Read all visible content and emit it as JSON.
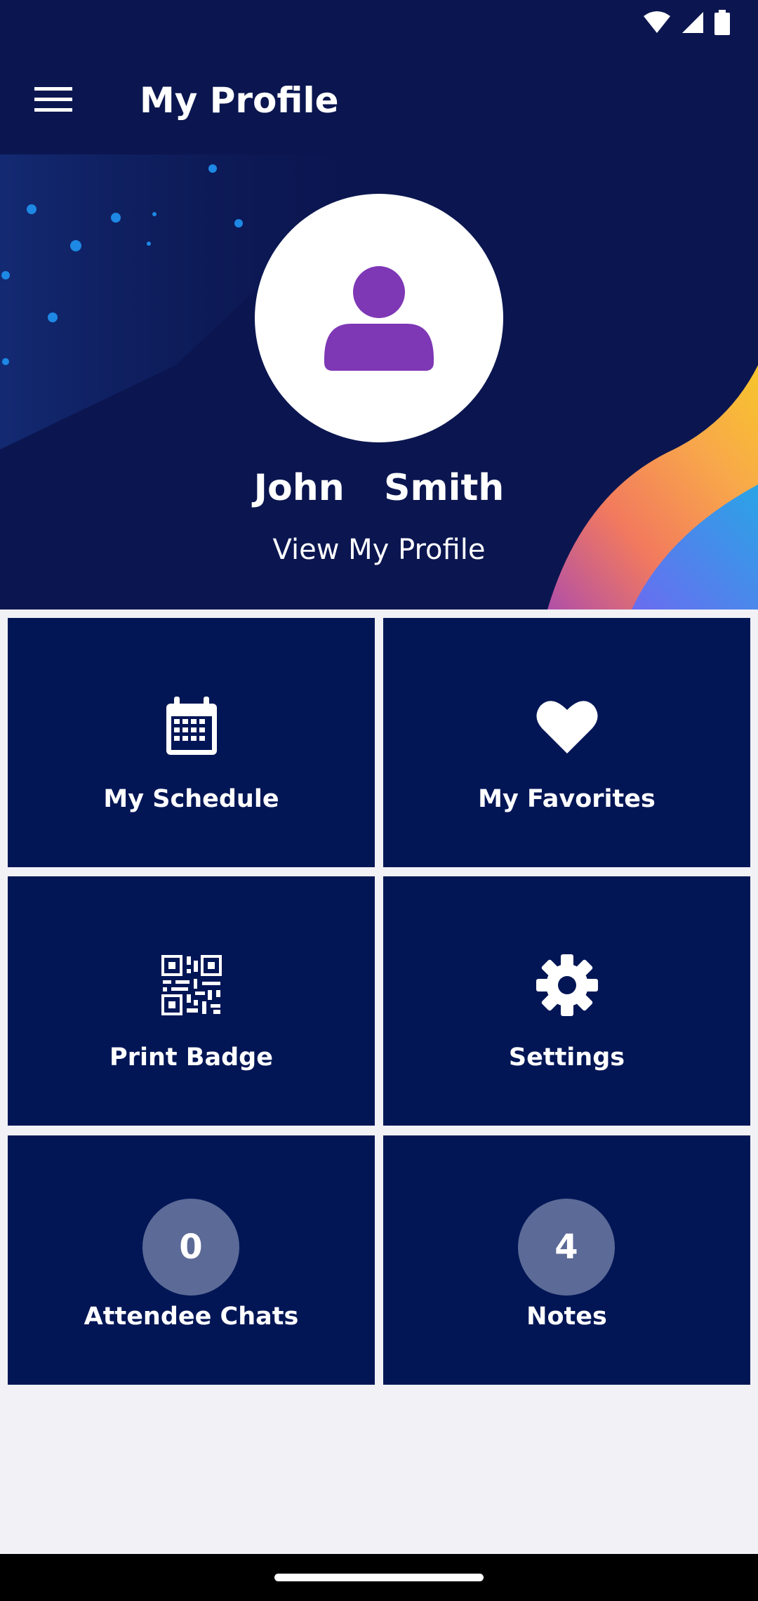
{
  "app_bar": {
    "title": "My Profile",
    "menu_icon": "hamburger-menu-icon"
  },
  "status_bar": {
    "icons": [
      "wifi-icon",
      "cellular-signal-icon",
      "battery-icon"
    ]
  },
  "profile": {
    "name": "John  Smith",
    "link": "View My Profile",
    "avatar_icon": "person-icon",
    "avatar_color": "#7e37b5"
  },
  "tiles": [
    {
      "label": "My Schedule",
      "icon": "calendar-icon"
    },
    {
      "label": "My Favorites",
      "icon": "heart-icon"
    },
    {
      "label": "Print Badge",
      "icon": "qr-code-icon"
    },
    {
      "label": "Settings",
      "icon": "gear-icon"
    },
    {
      "label": "Attendee Chats",
      "count": "0"
    },
    {
      "label": "Notes",
      "count": "4"
    }
  ],
  "colors": {
    "header_bg": "#0b1650",
    "tile_bg": "#021656",
    "badge_bg": "#5c6a97",
    "page_bg": "#f1f1f6"
  }
}
